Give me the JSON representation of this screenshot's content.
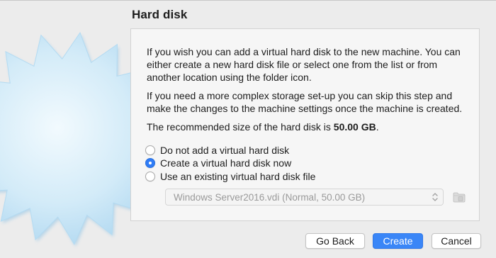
{
  "window": {
    "title": ""
  },
  "page": {
    "title": "Hard disk",
    "paragraph_1": "If you wish you can add a virtual hard disk to the new machine. You can either create a new hard disk file or select one from the list or from another location using the folder icon.",
    "paragraph_2": "If you need a more complex storage set-up you can skip this step and make the changes to the machine settings once the machine is created.",
    "recommended_prefix": "The recommended size of the hard disk is ",
    "recommended_size": "50.00 GB",
    "recommended_suffix": "."
  },
  "options": [
    {
      "label": "Do not add a virtual hard disk",
      "checked": false
    },
    {
      "label": "Create a virtual hard disk now",
      "checked": true
    },
    {
      "label": "Use an existing virtual hard disk file",
      "checked": false
    }
  ],
  "disk_select": {
    "value": "Windows Server2016.vdi (Normal, 50.00 GB)",
    "enabled": false
  },
  "icons": {
    "select_arrows": "chevron-up-down-icon",
    "folder": "folder-icon",
    "sidebar": "starburst-graphic"
  },
  "buttons": {
    "back": "Go Back",
    "create": "Create",
    "cancel": "Cancel"
  },
  "colors": {
    "accent": "#3a86f7",
    "window_bg": "#ececec",
    "panel_bg": "#f6f6f6",
    "starburst": "#bfe0f4"
  }
}
